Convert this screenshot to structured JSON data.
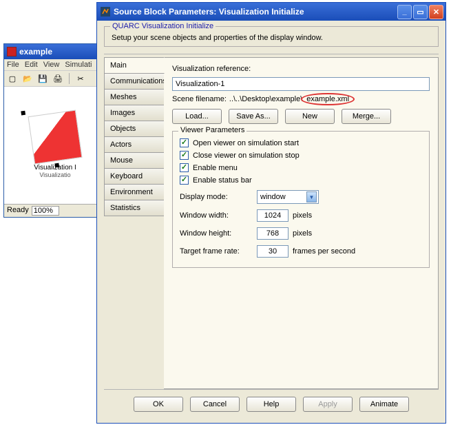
{
  "bgWindow": {
    "title": "example",
    "menu": [
      "File",
      "Edit",
      "View",
      "Simulati"
    ],
    "canvas": {
      "label": "Visualization I",
      "sublabel": "Visualizatio"
    },
    "status": {
      "ready": "Ready",
      "zoom": "100%"
    }
  },
  "dialog": {
    "title": "Source Block Parameters: Visualization Initialize",
    "group": {
      "legend": "QUARC Visualization Initialize",
      "desc": "Setup your scene objects and properties of the display window."
    },
    "tabs": [
      "Main",
      "Communications",
      "Meshes",
      "Images",
      "Objects",
      "Actors",
      "Mouse",
      "Keyboard",
      "Environment",
      "Statistics"
    ],
    "activeTab": 0,
    "main": {
      "refLabel": "Visualization reference:",
      "refValue": "Visualization-1",
      "sceneLabel": "Scene filename:",
      "scenePath": "..\\..\\Desktop\\example\\",
      "sceneFile": "example.xml",
      "buttons": {
        "load": "Load...",
        "saveAs": "Save As...",
        "new": "New",
        "merge": "Merge..."
      },
      "viewer": {
        "legend": "Viewer Parameters",
        "checks": {
          "openOnStart": {
            "label": "Open viewer on simulation start",
            "checked": true
          },
          "closeOnStop": {
            "label": "Close viewer on simulation stop",
            "checked": true
          },
          "enableMenu": {
            "label": "Enable menu",
            "checked": true
          },
          "enableStatus": {
            "label": "Enable status bar",
            "checked": true
          }
        },
        "displayMode": {
          "label": "Display mode:",
          "value": "window"
        },
        "windowWidth": {
          "label": "Window width:",
          "value": "1024",
          "unit": "pixels"
        },
        "windowHeight": {
          "label": "Window height:",
          "value": "768",
          "unit": "pixels"
        },
        "frameRate": {
          "label": "Target frame rate:",
          "value": "30",
          "unit": "frames per second"
        }
      }
    },
    "bottom": {
      "ok": "OK",
      "cancel": "Cancel",
      "help": "Help",
      "apply": "Apply",
      "animate": "Animate"
    }
  }
}
